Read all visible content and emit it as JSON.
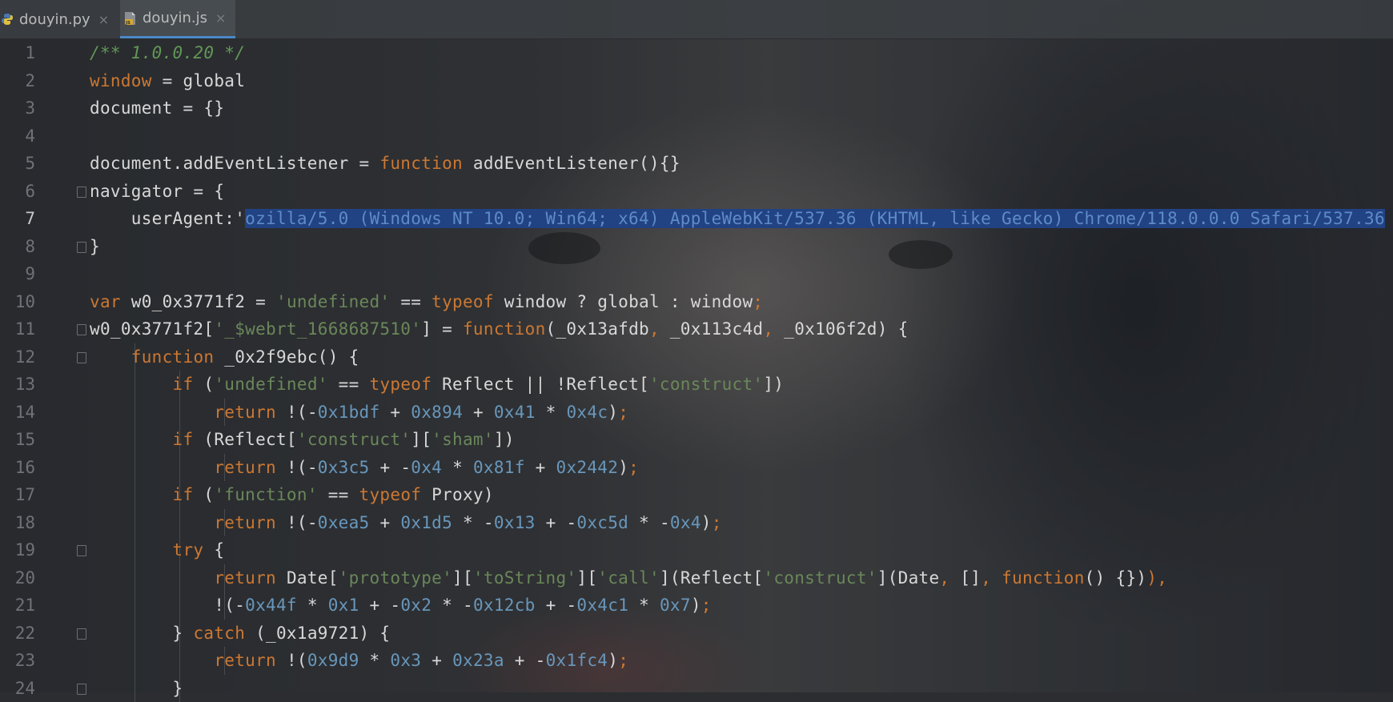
{
  "tabs": [
    {
      "label": "douyin.py",
      "icon": "python-file-icon",
      "close": "×",
      "active": false
    },
    {
      "label": "douyin.js",
      "icon": "js-file-icon",
      "close": "×",
      "active": true
    }
  ],
  "editor": {
    "current_line": 7,
    "lines": [
      {
        "num": "1",
        "segs": [
          [
            "c",
            "/** 1.0.0.20 */"
          ]
        ]
      },
      {
        "num": "2",
        "segs": [
          [
            "k",
            "window"
          ],
          [
            "p",
            " = global"
          ]
        ]
      },
      {
        "num": "3",
        "segs": [
          [
            "p",
            "document = {}"
          ]
        ]
      },
      {
        "num": "4",
        "segs": []
      },
      {
        "num": "5",
        "segs": [
          [
            "p",
            "document.addEventListener = "
          ],
          [
            "k",
            "function"
          ],
          [
            "p",
            " addEventListener(){}"
          ]
        ]
      },
      {
        "num": "6",
        "segs": [
          [
            "p",
            "navigator = {"
          ]
        ]
      },
      {
        "num": "7",
        "segs": [
          [
            "p",
            "    userAgent:'"
          ],
          [
            "sel",
            "ozilla/5.0 (Windows NT 10.0; Win64; x64) AppleWebKit/537.36 (KHTML, like Gecko) Chrome/118.0.0.0 Safari/537.36"
          ]
        ]
      },
      {
        "num": "8",
        "segs": [
          [
            "p",
            "}"
          ]
        ]
      },
      {
        "num": "9",
        "segs": []
      },
      {
        "num": "10",
        "segs": [
          [
            "k",
            "var"
          ],
          [
            "p",
            " w0_0x3771f2 = "
          ],
          [
            "s",
            "'undefined'"
          ],
          [
            "p",
            " == "
          ],
          [
            "k",
            "typeof"
          ],
          [
            "p",
            " window ? global : window"
          ],
          [
            "k",
            ";"
          ]
        ]
      },
      {
        "num": "11",
        "segs": [
          [
            "p",
            "w0_0x3771f2["
          ],
          [
            "s",
            "'_$webrt_1668687510'"
          ],
          [
            "p",
            "] = "
          ],
          [
            "k",
            "function"
          ],
          [
            "p",
            "(_0x13afdb"
          ],
          [
            "k",
            ","
          ],
          [
            "p",
            " _0x113c4d"
          ],
          [
            "k",
            ","
          ],
          [
            "p",
            " _0x106f2d) {"
          ]
        ]
      },
      {
        "num": "12",
        "segs": [
          [
            "p",
            "    "
          ],
          [
            "k",
            "function"
          ],
          [
            "p",
            " _0x2f9ebc() {"
          ]
        ]
      },
      {
        "num": "13",
        "segs": [
          [
            "p",
            "        "
          ],
          [
            "k",
            "if"
          ],
          [
            "p",
            " ("
          ],
          [
            "s",
            "'undefined'"
          ],
          [
            "p",
            " == "
          ],
          [
            "k",
            "typeof"
          ],
          [
            "p",
            " Reflect || !Reflect["
          ],
          [
            "s",
            "'construct'"
          ],
          [
            "p",
            "])"
          ]
        ]
      },
      {
        "num": "14",
        "segs": [
          [
            "p",
            "            "
          ],
          [
            "k",
            "return"
          ],
          [
            "p",
            " !(-"
          ],
          [
            "n",
            "0x1bdf"
          ],
          [
            "p",
            " + "
          ],
          [
            "n",
            "0x894"
          ],
          [
            "p",
            " + "
          ],
          [
            "n",
            "0x41"
          ],
          [
            "p",
            " * "
          ],
          [
            "n",
            "0x4c"
          ],
          [
            "p",
            ")"
          ],
          [
            "k",
            ";"
          ]
        ]
      },
      {
        "num": "15",
        "segs": [
          [
            "p",
            "        "
          ],
          [
            "k",
            "if"
          ],
          [
            "p",
            " (Reflect["
          ],
          [
            "s",
            "'construct'"
          ],
          [
            "p",
            "]["
          ],
          [
            "s",
            "'sham'"
          ],
          [
            "p",
            "])"
          ]
        ]
      },
      {
        "num": "16",
        "segs": [
          [
            "p",
            "            "
          ],
          [
            "k",
            "return"
          ],
          [
            "p",
            " !(-"
          ],
          [
            "n",
            "0x3c5"
          ],
          [
            "p",
            " + -"
          ],
          [
            "n",
            "0x4"
          ],
          [
            "p",
            " * "
          ],
          [
            "n",
            "0x81f"
          ],
          [
            "p",
            " + "
          ],
          [
            "n",
            "0x2442"
          ],
          [
            "p",
            ")"
          ],
          [
            "k",
            ";"
          ]
        ]
      },
      {
        "num": "17",
        "segs": [
          [
            "p",
            "        "
          ],
          [
            "k",
            "if"
          ],
          [
            "p",
            " ("
          ],
          [
            "s",
            "'function'"
          ],
          [
            "p",
            " == "
          ],
          [
            "k",
            "typeof"
          ],
          [
            "p",
            " Proxy)"
          ]
        ]
      },
      {
        "num": "18",
        "segs": [
          [
            "p",
            "            "
          ],
          [
            "k",
            "return"
          ],
          [
            "p",
            " !(-"
          ],
          [
            "n",
            "0xea5"
          ],
          [
            "p",
            " + "
          ],
          [
            "n",
            "0x1d5"
          ],
          [
            "p",
            " * -"
          ],
          [
            "n",
            "0x13"
          ],
          [
            "p",
            " + -"
          ],
          [
            "n",
            "0xc5d"
          ],
          [
            "p",
            " * -"
          ],
          [
            "n",
            "0x4"
          ],
          [
            "p",
            ")"
          ],
          [
            "k",
            ";"
          ]
        ]
      },
      {
        "num": "19",
        "segs": [
          [
            "p",
            "        "
          ],
          [
            "k",
            "try"
          ],
          [
            "p",
            " {"
          ]
        ]
      },
      {
        "num": "20",
        "segs": [
          [
            "p",
            "            "
          ],
          [
            "k",
            "return"
          ],
          [
            "p",
            " Date["
          ],
          [
            "s",
            "'prototype'"
          ],
          [
            "p",
            "]["
          ],
          [
            "s",
            "'toString'"
          ],
          [
            "p",
            "]["
          ],
          [
            "s",
            "'call'"
          ],
          [
            "p",
            "](Reflect["
          ],
          [
            "s",
            "'construct'"
          ],
          [
            "p",
            "](Date"
          ],
          [
            "k",
            ","
          ],
          [
            "p",
            " []"
          ],
          [
            "k",
            ","
          ],
          [
            "p",
            " "
          ],
          [
            "k",
            "function"
          ],
          [
            "p",
            "() {})"
          ],
          [
            "k",
            ")"
          ],
          [
            "k",
            ","
          ]
        ]
      },
      {
        "num": "21",
        "segs": [
          [
            "p",
            "            !(-"
          ],
          [
            "n",
            "0x44f"
          ],
          [
            "p",
            " * "
          ],
          [
            "n",
            "0x1"
          ],
          [
            "p",
            " + -"
          ],
          [
            "n",
            "0x2"
          ],
          [
            "p",
            " * -"
          ],
          [
            "n",
            "0x12cb"
          ],
          [
            "p",
            " + -"
          ],
          [
            "n",
            "0x4c1"
          ],
          [
            "p",
            " * "
          ],
          [
            "n",
            "0x7"
          ],
          [
            "p",
            ")"
          ],
          [
            "k",
            ";"
          ]
        ]
      },
      {
        "num": "22",
        "segs": [
          [
            "p",
            "        } "
          ],
          [
            "k",
            "catch"
          ],
          [
            "p",
            " (_0x1a9721) {"
          ]
        ]
      },
      {
        "num": "23",
        "segs": [
          [
            "p",
            "            "
          ],
          [
            "k",
            "return"
          ],
          [
            "p",
            " !("
          ],
          [
            "n",
            "0x9d9"
          ],
          [
            "p",
            " * "
          ],
          [
            "n",
            "0x3"
          ],
          [
            "p",
            " + "
          ],
          [
            "n",
            "0x23a"
          ],
          [
            "p",
            " + -"
          ],
          [
            "n",
            "0x1fc4"
          ],
          [
            "p",
            ")"
          ],
          [
            "k",
            ";"
          ]
        ]
      },
      {
        "num": "24",
        "segs": [
          [
            "p",
            "        }"
          ]
        ]
      }
    ]
  }
}
